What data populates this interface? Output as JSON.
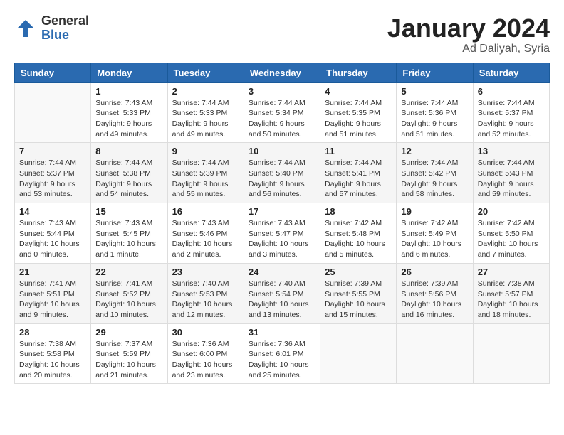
{
  "header": {
    "logo_general": "General",
    "logo_blue": "Blue",
    "title": "January 2024",
    "subtitle": "Ad Daliyah, Syria"
  },
  "weekdays": [
    "Sunday",
    "Monday",
    "Tuesday",
    "Wednesday",
    "Thursday",
    "Friday",
    "Saturday"
  ],
  "weeks": [
    [
      {
        "day": "",
        "sunrise": "",
        "sunset": "",
        "daylight": ""
      },
      {
        "day": "1",
        "sunrise": "Sunrise: 7:43 AM",
        "sunset": "Sunset: 5:33 PM",
        "daylight": "Daylight: 9 hours and 49 minutes."
      },
      {
        "day": "2",
        "sunrise": "Sunrise: 7:44 AM",
        "sunset": "Sunset: 5:33 PM",
        "daylight": "Daylight: 9 hours and 49 minutes."
      },
      {
        "day": "3",
        "sunrise": "Sunrise: 7:44 AM",
        "sunset": "Sunset: 5:34 PM",
        "daylight": "Daylight: 9 hours and 50 minutes."
      },
      {
        "day": "4",
        "sunrise": "Sunrise: 7:44 AM",
        "sunset": "Sunset: 5:35 PM",
        "daylight": "Daylight: 9 hours and 51 minutes."
      },
      {
        "day": "5",
        "sunrise": "Sunrise: 7:44 AM",
        "sunset": "Sunset: 5:36 PM",
        "daylight": "Daylight: 9 hours and 51 minutes."
      },
      {
        "day": "6",
        "sunrise": "Sunrise: 7:44 AM",
        "sunset": "Sunset: 5:37 PM",
        "daylight": "Daylight: 9 hours and 52 minutes."
      }
    ],
    [
      {
        "day": "7",
        "sunrise": "Sunrise: 7:44 AM",
        "sunset": "Sunset: 5:37 PM",
        "daylight": "Daylight: 9 hours and 53 minutes."
      },
      {
        "day": "8",
        "sunrise": "Sunrise: 7:44 AM",
        "sunset": "Sunset: 5:38 PM",
        "daylight": "Daylight: 9 hours and 54 minutes."
      },
      {
        "day": "9",
        "sunrise": "Sunrise: 7:44 AM",
        "sunset": "Sunset: 5:39 PM",
        "daylight": "Daylight: 9 hours and 55 minutes."
      },
      {
        "day": "10",
        "sunrise": "Sunrise: 7:44 AM",
        "sunset": "Sunset: 5:40 PM",
        "daylight": "Daylight: 9 hours and 56 minutes."
      },
      {
        "day": "11",
        "sunrise": "Sunrise: 7:44 AM",
        "sunset": "Sunset: 5:41 PM",
        "daylight": "Daylight: 9 hours and 57 minutes."
      },
      {
        "day": "12",
        "sunrise": "Sunrise: 7:44 AM",
        "sunset": "Sunset: 5:42 PM",
        "daylight": "Daylight: 9 hours and 58 minutes."
      },
      {
        "day": "13",
        "sunrise": "Sunrise: 7:44 AM",
        "sunset": "Sunset: 5:43 PM",
        "daylight": "Daylight: 9 hours and 59 minutes."
      }
    ],
    [
      {
        "day": "14",
        "sunrise": "Sunrise: 7:43 AM",
        "sunset": "Sunset: 5:44 PM",
        "daylight": "Daylight: 10 hours and 0 minutes."
      },
      {
        "day": "15",
        "sunrise": "Sunrise: 7:43 AM",
        "sunset": "Sunset: 5:45 PM",
        "daylight": "Daylight: 10 hours and 1 minute."
      },
      {
        "day": "16",
        "sunrise": "Sunrise: 7:43 AM",
        "sunset": "Sunset: 5:46 PM",
        "daylight": "Daylight: 10 hours and 2 minutes."
      },
      {
        "day": "17",
        "sunrise": "Sunrise: 7:43 AM",
        "sunset": "Sunset: 5:47 PM",
        "daylight": "Daylight: 10 hours and 3 minutes."
      },
      {
        "day": "18",
        "sunrise": "Sunrise: 7:42 AM",
        "sunset": "Sunset: 5:48 PM",
        "daylight": "Daylight: 10 hours and 5 minutes."
      },
      {
        "day": "19",
        "sunrise": "Sunrise: 7:42 AM",
        "sunset": "Sunset: 5:49 PM",
        "daylight": "Daylight: 10 hours and 6 minutes."
      },
      {
        "day": "20",
        "sunrise": "Sunrise: 7:42 AM",
        "sunset": "Sunset: 5:50 PM",
        "daylight": "Daylight: 10 hours and 7 minutes."
      }
    ],
    [
      {
        "day": "21",
        "sunrise": "Sunrise: 7:41 AM",
        "sunset": "Sunset: 5:51 PM",
        "daylight": "Daylight: 10 hours and 9 minutes."
      },
      {
        "day": "22",
        "sunrise": "Sunrise: 7:41 AM",
        "sunset": "Sunset: 5:52 PM",
        "daylight": "Daylight: 10 hours and 10 minutes."
      },
      {
        "day": "23",
        "sunrise": "Sunrise: 7:40 AM",
        "sunset": "Sunset: 5:53 PM",
        "daylight": "Daylight: 10 hours and 12 minutes."
      },
      {
        "day": "24",
        "sunrise": "Sunrise: 7:40 AM",
        "sunset": "Sunset: 5:54 PM",
        "daylight": "Daylight: 10 hours and 13 minutes."
      },
      {
        "day": "25",
        "sunrise": "Sunrise: 7:39 AM",
        "sunset": "Sunset: 5:55 PM",
        "daylight": "Daylight: 10 hours and 15 minutes."
      },
      {
        "day": "26",
        "sunrise": "Sunrise: 7:39 AM",
        "sunset": "Sunset: 5:56 PM",
        "daylight": "Daylight: 10 hours and 16 minutes."
      },
      {
        "day": "27",
        "sunrise": "Sunrise: 7:38 AM",
        "sunset": "Sunset: 5:57 PM",
        "daylight": "Daylight: 10 hours and 18 minutes."
      }
    ],
    [
      {
        "day": "28",
        "sunrise": "Sunrise: 7:38 AM",
        "sunset": "Sunset: 5:58 PM",
        "daylight": "Daylight: 10 hours and 20 minutes."
      },
      {
        "day": "29",
        "sunrise": "Sunrise: 7:37 AM",
        "sunset": "Sunset: 5:59 PM",
        "daylight": "Daylight: 10 hours and 21 minutes."
      },
      {
        "day": "30",
        "sunrise": "Sunrise: 7:36 AM",
        "sunset": "Sunset: 6:00 PM",
        "daylight": "Daylight: 10 hours and 23 minutes."
      },
      {
        "day": "31",
        "sunrise": "Sunrise: 7:36 AM",
        "sunset": "Sunset: 6:01 PM",
        "daylight": "Daylight: 10 hours and 25 minutes."
      },
      {
        "day": "",
        "sunrise": "",
        "sunset": "",
        "daylight": ""
      },
      {
        "day": "",
        "sunrise": "",
        "sunset": "",
        "daylight": ""
      },
      {
        "day": "",
        "sunrise": "",
        "sunset": "",
        "daylight": ""
      }
    ]
  ]
}
